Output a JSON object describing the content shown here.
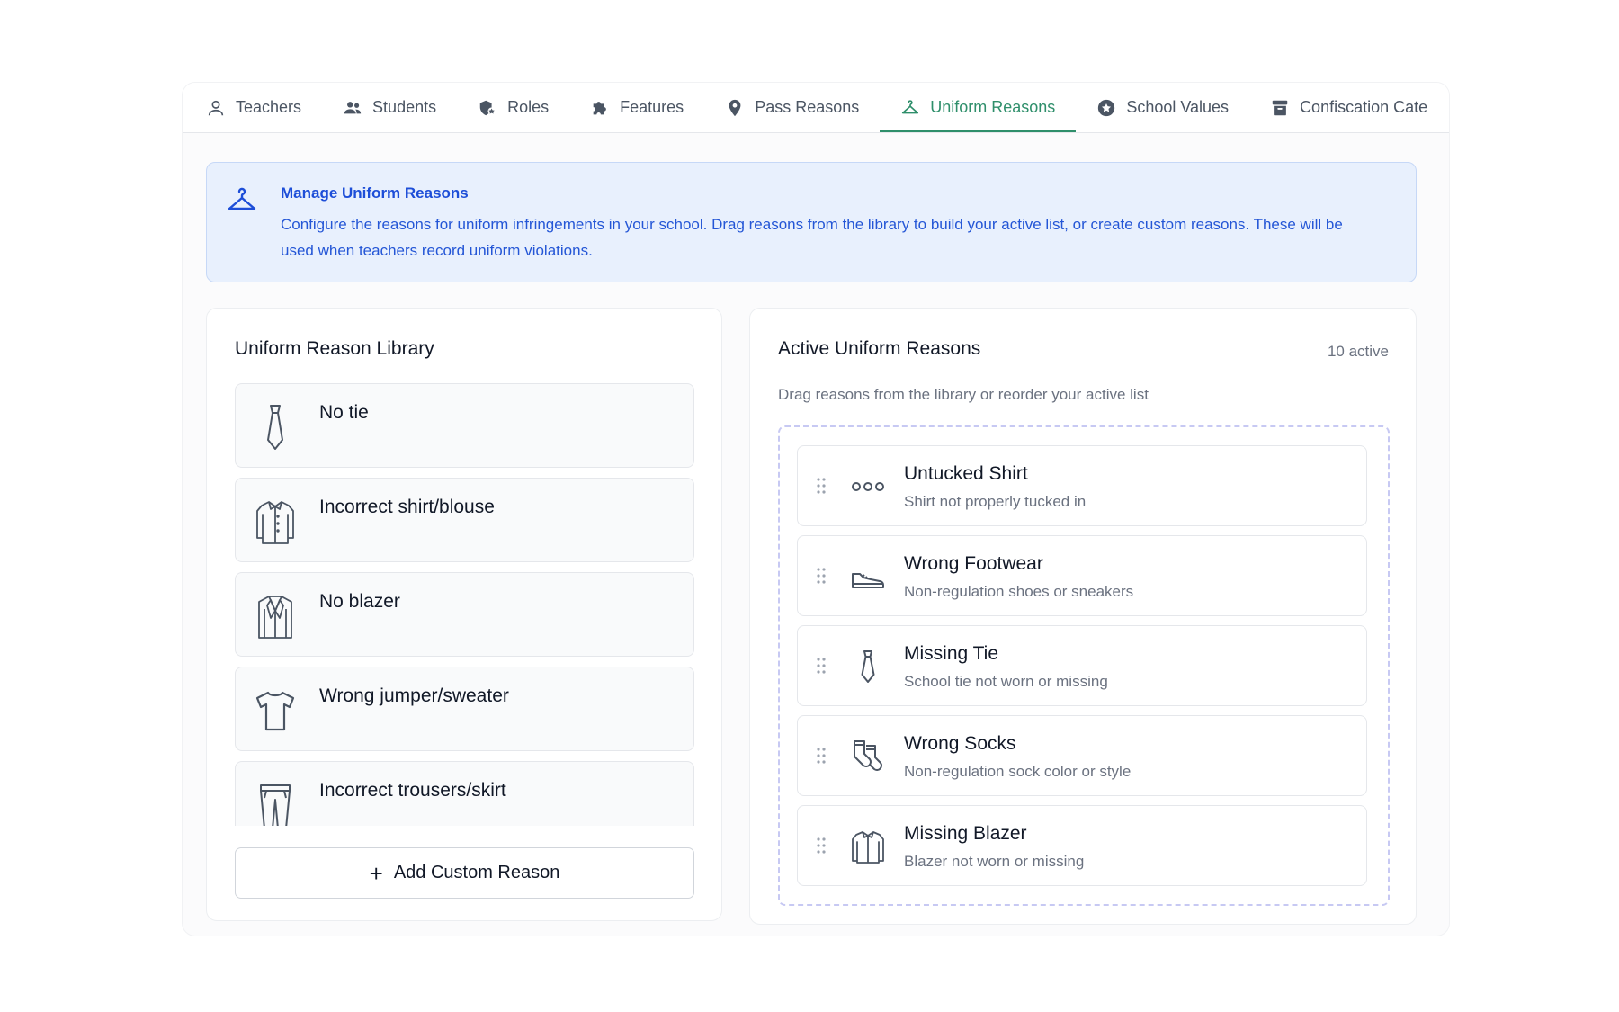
{
  "tabs": [
    {
      "label": "Teachers",
      "icon": "user-outline-icon"
    },
    {
      "label": "Students",
      "icon": "users-icon"
    },
    {
      "label": "Roles",
      "icon": "badge-shield-icon"
    },
    {
      "label": "Features",
      "icon": "puzzle-icon"
    },
    {
      "label": "Pass Reasons",
      "icon": "map-pin-icon"
    },
    {
      "label": "Uniform Reasons",
      "icon": "hanger-icon",
      "active": true
    },
    {
      "label": "School Values",
      "icon": "star-circle-icon"
    },
    {
      "label": "Confiscation Cate",
      "icon": "archive-box-icon"
    }
  ],
  "banner": {
    "title": "Manage Uniform Reasons",
    "text": "Configure the reasons for uniform infringements in your school. Drag reasons from the library to build your active list, or create custom reasons. These will be used when teachers record uniform violations.",
    "icon": "hanger-icon"
  },
  "library": {
    "title": "Uniform Reason Library",
    "items": [
      {
        "label": "No tie",
        "icon": "tie-icon"
      },
      {
        "label": "Incorrect shirt/blouse",
        "icon": "shirt-icon"
      },
      {
        "label": "No blazer",
        "icon": "blazer-icon"
      },
      {
        "label": "Wrong jumper/sweater",
        "icon": "tshirt-icon"
      },
      {
        "label": "Incorrect trousers/skirt",
        "icon": "trousers-icon"
      }
    ],
    "add_label": "Add Custom Reason"
  },
  "active": {
    "title": "Active Uniform Reasons",
    "count": "10 active",
    "subtitle": "Drag reasons from the library or reorder your active list",
    "items": [
      {
        "name": "Untucked Shirt",
        "desc": "Shirt not properly tucked in",
        "icon": "three-circles-icon"
      },
      {
        "name": "Wrong Footwear",
        "desc": "Non-regulation shoes or sneakers",
        "icon": "sneaker-icon"
      },
      {
        "name": "Missing Tie",
        "desc": "School tie not worn or missing",
        "icon": "tie-icon"
      },
      {
        "name": "Wrong Socks",
        "desc": "Non-regulation sock color or style",
        "icon": "socks-icon"
      },
      {
        "name": "Missing Blazer",
        "desc": "Blazer not worn or missing",
        "icon": "shirt-icon"
      }
    ]
  },
  "colors": {
    "accent_green": "#2f8f6b",
    "info_blue": "#1d4ed8",
    "info_bg": "#e8f0fd",
    "dropzone_border": "#c7c9f3"
  }
}
